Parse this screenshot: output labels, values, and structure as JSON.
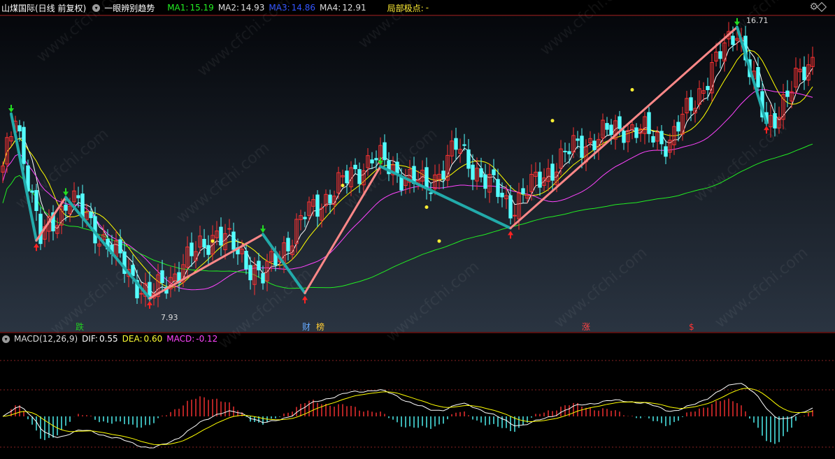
{
  "header": {
    "stock": "山煤国际(日线 前复权)",
    "indicator_name": "一眼辨别趋势",
    "ma1_label": "MA1:",
    "ma1_value": "15.19",
    "ma2_label": "MA2:",
    "ma2_value": "14.93",
    "ma3_label": "MA3:",
    "ma3_value": "14.86",
    "ma4_label": "MA4:",
    "ma4_value": "12.91",
    "extreme_label": "局部极点:",
    "extreme_value": "-"
  },
  "macd_header": {
    "title": "MACD(12,26,9)",
    "dif_label": "DIF:",
    "dif_value": "0.55",
    "dea_label": "DEA:",
    "dea_value": "0.60",
    "macd_label": "MACD:",
    "macd_value": "-0.12"
  },
  "annotations": {
    "low_price": "7.93",
    "high_price": "16.71"
  },
  "events": [
    {
      "text": "跌",
      "color": "#22cc22"
    },
    {
      "text": "财",
      "color": "#66aaff"
    },
    {
      "text": "榜",
      "color": "#ffcc33"
    },
    {
      "text": "涨",
      "color": "#ff4444"
    },
    {
      "text": "$",
      "color": "#ff3333"
    }
  ],
  "watermark": "www.cfchi.com",
  "colors": {
    "up": "#ff3232",
    "down": "#54ffff",
    "ma1": "#ffffff",
    "ma2": "#ffff00",
    "ma3": "#ff44ff",
    "ma4": "#22ee22",
    "trend_up": "#ff8888",
    "trend_down": "#22aaaa",
    "dif": "#ffffff",
    "dea": "#ffff00"
  },
  "chart_data": {
    "type": "candlestick",
    "y_min": 7.0,
    "y_max": 17.0,
    "pivots": [
      {
        "i": 0,
        "p": 12.0
      },
      {
        "i": 3,
        "p": 13.9
      },
      {
        "i": 9,
        "p": 9.8
      },
      {
        "i": 16,
        "p": 11.2
      },
      {
        "i": 35,
        "p": 7.93
      },
      {
        "i": 51,
        "p": 10.1
      },
      {
        "i": 62,
        "p": 8.6
      },
      {
        "i": 72,
        "p": 10.6
      },
      {
        "i": 88,
        "p": 12.5
      },
      {
        "i": 101,
        "p": 11.5
      },
      {
        "i": 108,
        "p": 12.8
      },
      {
        "i": 121,
        "p": 10.9
      },
      {
        "i": 136,
        "p": 12.8
      },
      {
        "i": 148,
        "p": 13.5
      },
      {
        "i": 159,
        "p": 13.0
      },
      {
        "i": 175,
        "p": 16.71
      },
      {
        "i": 182,
        "p": 13.5
      },
      {
        "i": 192,
        "p": 15.5
      }
    ],
    "zigzag": [
      {
        "i": 2,
        "p": 13.9
      },
      {
        "i": 8,
        "p": 9.8
      },
      {
        "i": 15,
        "p": 11.2
      },
      {
        "i": 35,
        "p": 7.93
      },
      {
        "i": 62,
        "p": 10.0
      },
      {
        "i": 72,
        "p": 8.1
      },
      {
        "i": 90,
        "p": 12.2
      },
      {
        "i": 121,
        "p": 10.2
      },
      {
        "i": 175,
        "p": 16.71
      },
      {
        "i": 182,
        "p": 13.6
      }
    ]
  }
}
